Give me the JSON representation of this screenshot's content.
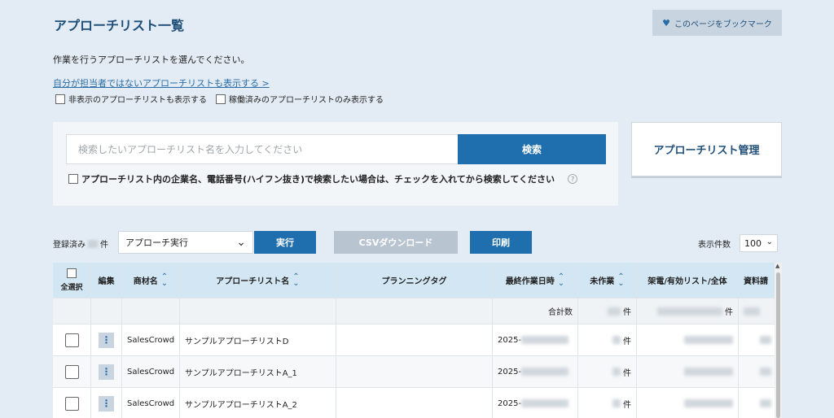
{
  "header": {
    "title": "アプローチリスト一覧",
    "bookmark_label": "このページをブックマーク"
  },
  "instruction": "作業を行うアプローチリストを選んでください。",
  "toggle_link": "自分が担当者ではないアプローチリストも表示する >",
  "filters": {
    "show_hidden": "非表示のアプローチリストも表示する",
    "show_active_only": "稼働済みのアプローチリストのみ表示する"
  },
  "search": {
    "placeholder": "検索したいアプローチリスト名を入力してください",
    "button": "検索",
    "company_option": "アプローチリスト内の企業名、電話番号(ハイフン抜き)で検索したい場合は、チェックを入れてから検索してください",
    "help_glyph": "?"
  },
  "manage_button": "アプローチリスト管理",
  "toolbar": {
    "registered_prefix": "登録済み",
    "registered_suffix": "件",
    "action_selected": "アプローチ実行",
    "run": "実行",
    "csv": "CSVダウンロード",
    "print": "印刷",
    "display_count_label": "表示件数",
    "display_count_value": "100"
  },
  "table": {
    "headers": {
      "select_all": "全選択",
      "edit": "編集",
      "product": "商材名",
      "list_name": "アプローチリスト名",
      "tag": "プランニングタグ",
      "last_date": "最終作業日時",
      "undone": "未作業",
      "calls": "架電/有効リスト/全体",
      "material": "資料請"
    },
    "total_label": "合計数",
    "count_suffix": "件",
    "rows": [
      {
        "product": "SalesCrowd",
        "name": "サンプルアプローチリストD",
        "date_prefix": "2025-"
      },
      {
        "product": "SalesCrowd",
        "name": "サンプルアプローチリストA_1",
        "date_prefix": "2025-"
      },
      {
        "product": "SalesCrowd",
        "name": "サンプルアプローチリストA_2",
        "date_prefix": "2025-"
      }
    ]
  },
  "icons": {
    "heart": "heart-icon",
    "chevron": "chevron-down-icon",
    "sort": "sort-icon",
    "kebab": "kebab-icon",
    "help": "help-icon"
  },
  "colors": {
    "background": "#e3ecf4",
    "primary_button": "#1f6eae",
    "title": "#1f4f78",
    "table_header": "#d2e6f3",
    "disabled_button": "#b8c5d1"
  }
}
